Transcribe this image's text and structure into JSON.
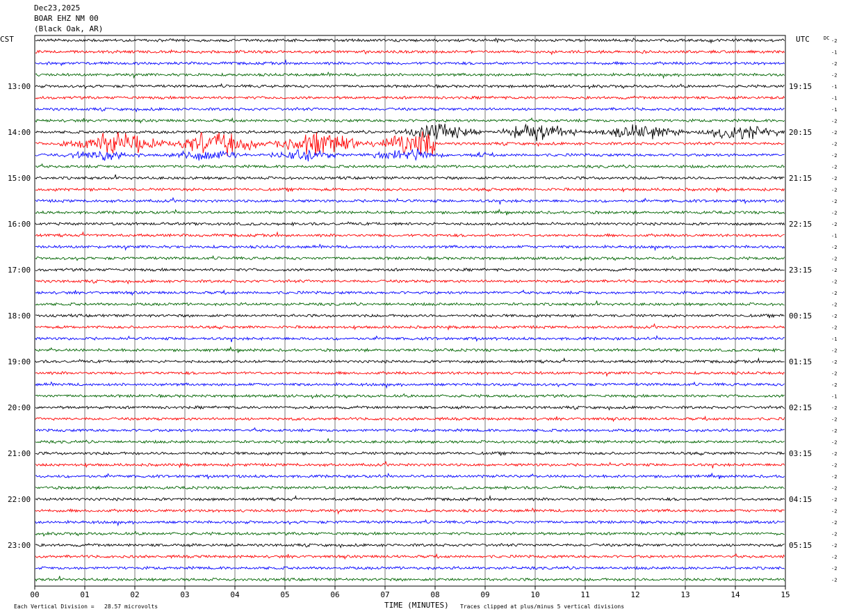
{
  "header": {
    "date": "Dec23,2025",
    "station": "BOAR EHZ NM 00",
    "location": "(Black Oak, AR)"
  },
  "left_timezone": "CST",
  "right_timezone": "UTC",
  "dc_label": "DC",
  "left_hour_labels": [
    "13:00",
    "14:00",
    "15:00",
    "16:00",
    "17:00",
    "18:00",
    "19:00",
    "20:00",
    "21:00",
    "22:00",
    "23:00"
  ],
  "right_hour_labels": [
    "19:15",
    "20:15",
    "21:15",
    "22:15",
    "23:15",
    "00:15",
    "01:15",
    "02:15",
    "03:15",
    "04:15",
    "05:15"
  ],
  "dc_offsets": [
    "-2",
    "-1",
    "-2",
    "-2",
    "-1",
    "-1",
    "-1",
    "-2",
    "-2",
    "-2",
    "-2",
    "-2",
    "-2",
    "-2",
    "-2",
    "-2",
    "-2",
    "-1",
    "-2",
    "-2",
    "-2",
    "-2",
    "-2",
    "-2",
    "-2",
    "-2",
    "-1",
    "-2",
    "-2",
    "-2",
    "-2",
    "-1",
    "-2",
    "-2",
    "-2",
    "-2",
    "-2",
    "-2",
    "-2",
    "-2",
    "-2",
    "-2",
    "-2",
    "-2",
    "-2",
    "-2",
    "-2",
    "-2",
    "-2",
    "-2",
    "-2",
    "-1"
  ],
  "footer": {
    "scale_note": "Each Vertical Division =   28.57 microvolts",
    "x_axis_title": "TIME (MINUTES)",
    "clip_note": "Traces clipped at plus/minus 5 vertical divisions"
  },
  "colors": {
    "trace_cycle": [
      "#000000",
      "#ff0000",
      "#0000ff",
      "#006400"
    ],
    "grid": "#000000"
  },
  "chart_data": {
    "type": "line",
    "title": "BOAR EHZ NM 00",
    "xlabel": "TIME (MINUTES)",
    "ylabel": "",
    "x_tick_labels": [
      "00",
      "01",
      "02",
      "03",
      "04",
      "05",
      "06",
      "07",
      "08",
      "09",
      "10",
      "11",
      "12",
      "13",
      "14",
      "15"
    ],
    "xlim": [
      0,
      15
    ],
    "rows_per_hour": 4,
    "row_count": 48,
    "start_hour_cst": "12:45",
    "amplitude_units": "vertical divisions",
    "clip_divisions": 5,
    "events": [
      {
        "row": 8,
        "start_min": 7.0,
        "end_min": 15.0,
        "amplitude": 3
      },
      {
        "row": 9,
        "start_min": 0.5,
        "end_min": 8.0,
        "amplitude": 5
      },
      {
        "row": 10,
        "start_min": 0.5,
        "end_min": 9.0,
        "amplitude": 2
      }
    ]
  }
}
